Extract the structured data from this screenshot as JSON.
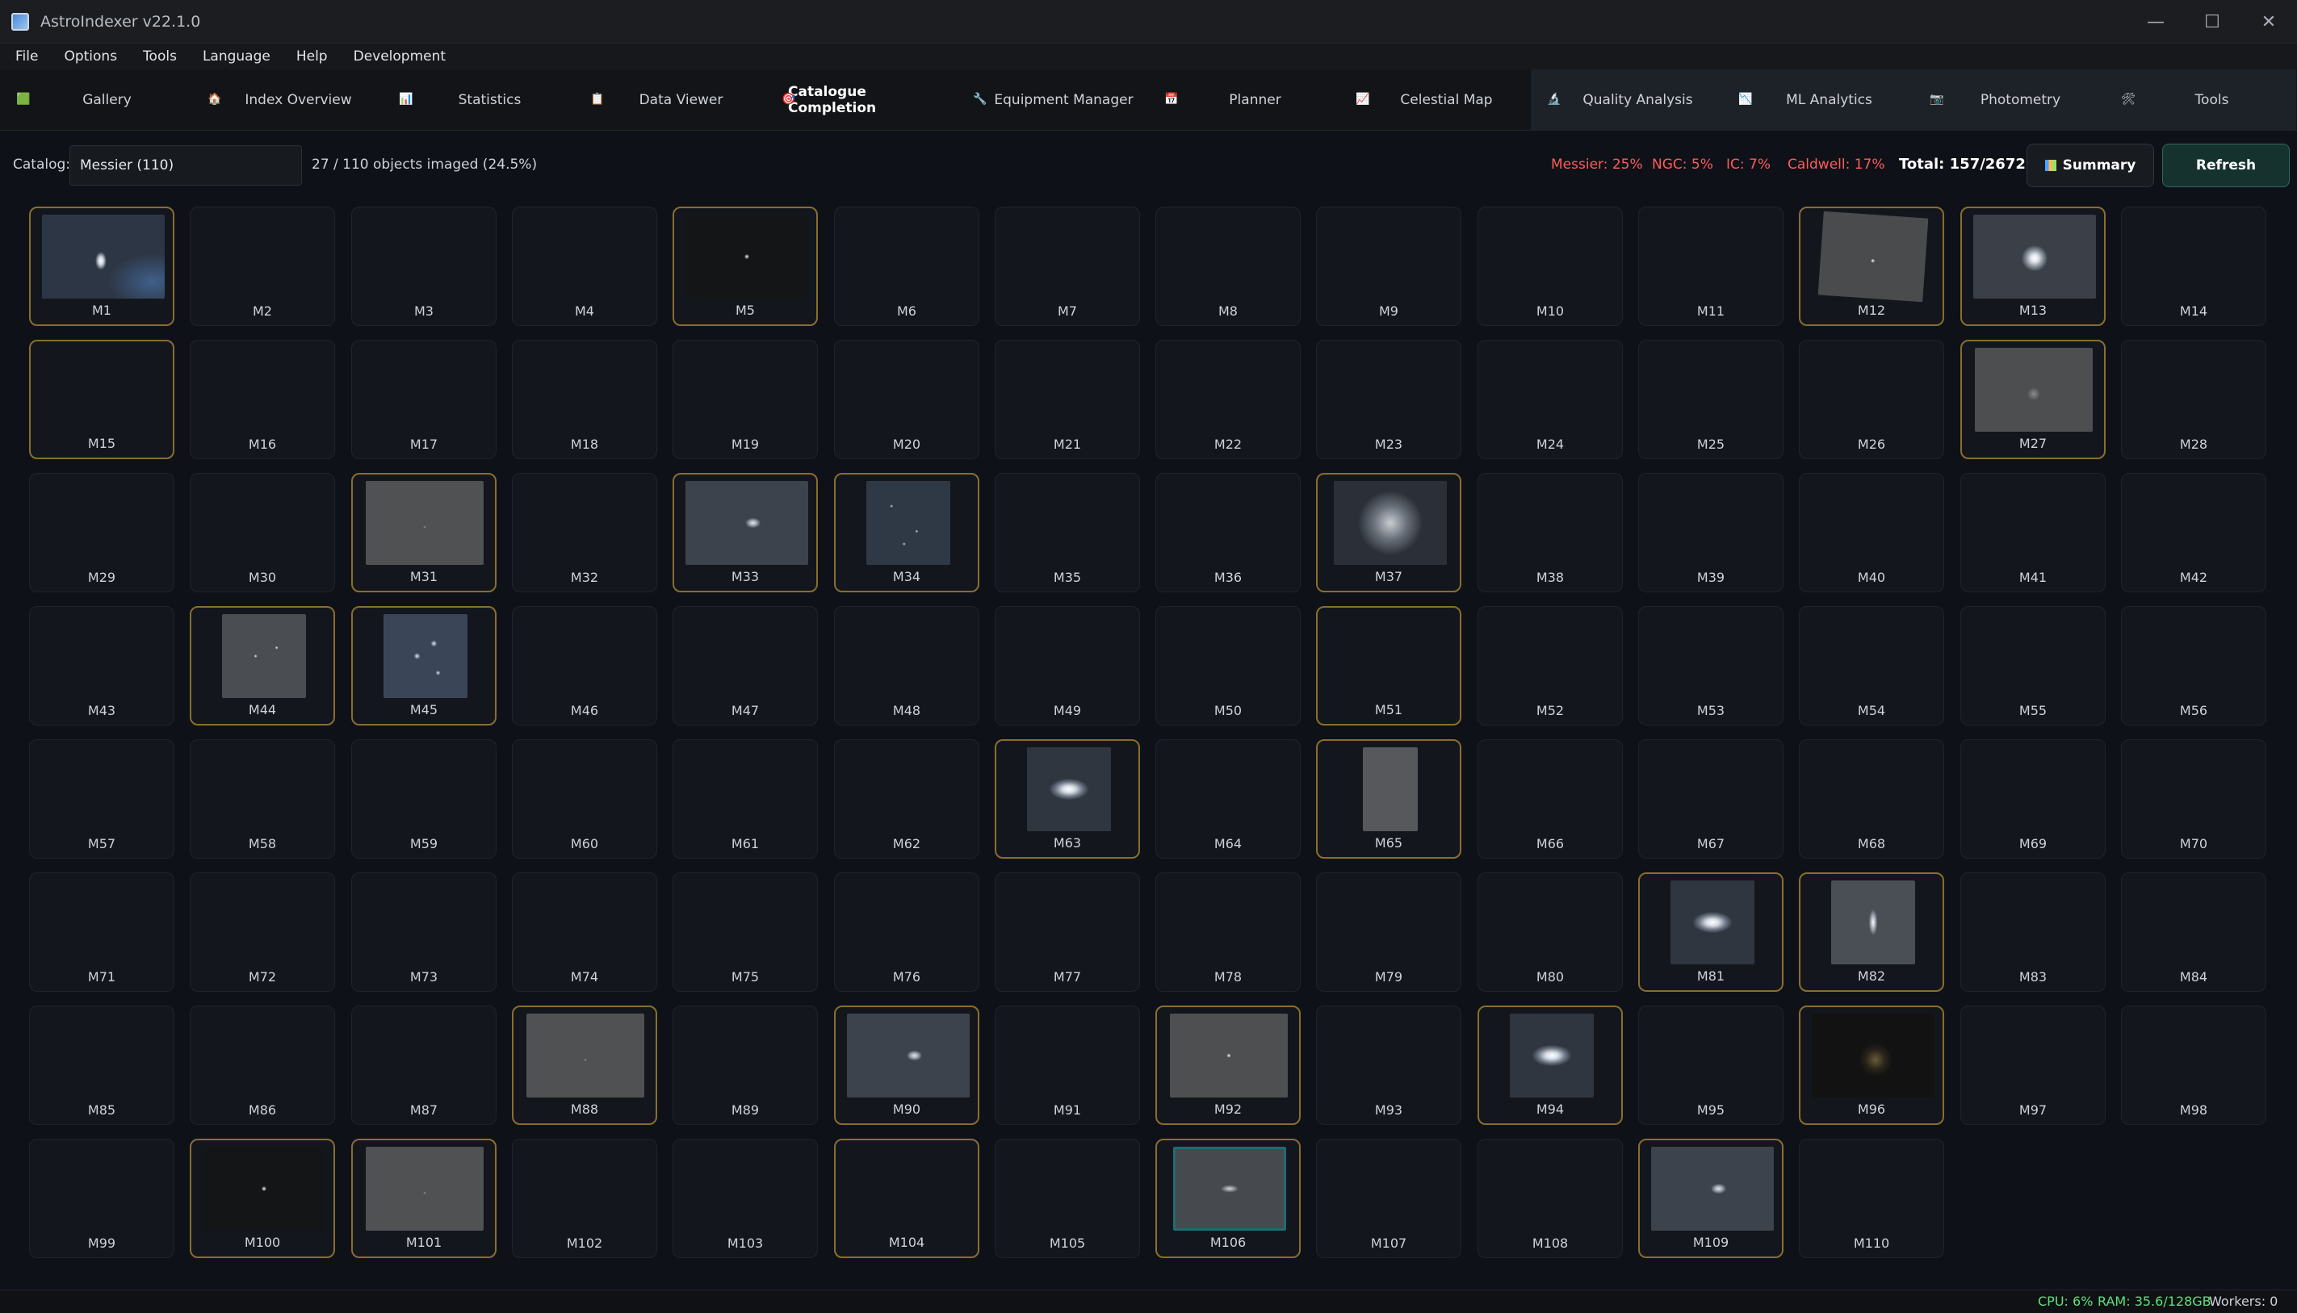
{
  "window": {
    "title": "AstroIndexer v22.1.0",
    "controls": {
      "minimize": "—",
      "maximize": "☐",
      "close": "✕"
    }
  },
  "menu": [
    "File",
    "Options",
    "Tools",
    "Language",
    "Help",
    "Development"
  ],
  "tabs": [
    {
      "label": "Gallery",
      "icon": "🟩",
      "dark": false,
      "active": false
    },
    {
      "label": "Index  Overview",
      "icon": "🏠",
      "dark": false,
      "active": false
    },
    {
      "label": "Statistics",
      "icon": "📊",
      "dark": false,
      "active": false
    },
    {
      "label": "Data Viewer",
      "icon": "📋",
      "dark": false,
      "active": false
    },
    {
      "label": "Catalogue Completion",
      "icon": "🎯",
      "dark": false,
      "active": true
    },
    {
      "label": "Equipment Manager",
      "icon": "🔧",
      "dark": false,
      "active": false
    },
    {
      "label": "Planner",
      "icon": "📅",
      "dark": false,
      "active": false
    },
    {
      "label": "Celestial Map",
      "icon": "📈",
      "dark": false,
      "active": false
    },
    {
      "label": "Quality Analysis",
      "icon": "🔬",
      "dark": true,
      "active": false
    },
    {
      "label": "ML Analytics",
      "icon": "📉",
      "dark": true,
      "active": false
    },
    {
      "label": "Photometry",
      "icon": "📷",
      "dark": true,
      "active": false
    },
    {
      "label": "Tools",
      "icon": "🛠",
      "dark": true,
      "active": false
    }
  ],
  "toolbar": {
    "catalog_label": "Catalog:",
    "catalog_value": "Messier (110)",
    "progress": "27 / 110 objects imaged (24.5%)",
    "stats": {
      "messier": "Messier: 25%",
      "ngc": "NGC: 5%",
      "ic": "IC: 7%",
      "caldwell": "Caldwell: 17%"
    },
    "total": "Total: 157/2672",
    "summary_label": "Summary",
    "refresh_label": "Refresh"
  },
  "objects": [
    {
      "id": "M1",
      "imaged": true,
      "thumb": "nebula-galaxy"
    },
    {
      "id": "M2",
      "imaged": false
    },
    {
      "id": "M3",
      "imaged": false
    },
    {
      "id": "M4",
      "imaged": false
    },
    {
      "id": "M5",
      "imaged": true,
      "thumb": "dark-point"
    },
    {
      "id": "M6",
      "imaged": false
    },
    {
      "id": "M7",
      "imaged": false
    },
    {
      "id": "M8",
      "imaged": false
    },
    {
      "id": "M9",
      "imaged": false
    },
    {
      "id": "M10",
      "imaged": false
    },
    {
      "id": "M11",
      "imaged": false
    },
    {
      "id": "M12",
      "imaged": true,
      "thumb": "gray-rotated"
    },
    {
      "id": "M13",
      "imaged": true,
      "thumb": "globular"
    },
    {
      "id": "M14",
      "imaged": false
    },
    {
      "id": "M15",
      "imaged": true,
      "thumb": "empty"
    },
    {
      "id": "M16",
      "imaged": false
    },
    {
      "id": "M17",
      "imaged": false
    },
    {
      "id": "M18",
      "imaged": false
    },
    {
      "id": "M19",
      "imaged": false
    },
    {
      "id": "M20",
      "imaged": false
    },
    {
      "id": "M21",
      "imaged": false
    },
    {
      "id": "M22",
      "imaged": false
    },
    {
      "id": "M23",
      "imaged": false
    },
    {
      "id": "M24",
      "imaged": false
    },
    {
      "id": "M25",
      "imaged": false
    },
    {
      "id": "M26",
      "imaged": false
    },
    {
      "id": "M27",
      "imaged": true,
      "thumb": "gray-blob"
    },
    {
      "id": "M28",
      "imaged": false
    },
    {
      "id": "M29",
      "imaged": false
    },
    {
      "id": "M30",
      "imaged": false
    },
    {
      "id": "M31",
      "imaged": true,
      "thumb": "gray-plain"
    },
    {
      "id": "M32",
      "imaged": false
    },
    {
      "id": "M33",
      "imaged": true,
      "thumb": "gray-galaxy"
    },
    {
      "id": "M34",
      "imaged": true,
      "thumb": "open-cluster"
    },
    {
      "id": "M35",
      "imaged": false
    },
    {
      "id": "M36",
      "imaged": false
    },
    {
      "id": "M37",
      "imaged": true,
      "thumb": "dense-cluster"
    },
    {
      "id": "M38",
      "imaged": false
    },
    {
      "id": "M39",
      "imaged": false
    },
    {
      "id": "M40",
      "imaged": false
    },
    {
      "id": "M41",
      "imaged": false
    },
    {
      "id": "M42",
      "imaged": false
    },
    {
      "id": "M43",
      "imaged": false
    },
    {
      "id": "M44",
      "imaged": true,
      "thumb": "sparse-cluster"
    },
    {
      "id": "M45",
      "imaged": true,
      "thumb": "pleiades"
    },
    {
      "id": "M46",
      "imaged": false
    },
    {
      "id": "M47",
      "imaged": false
    },
    {
      "id": "M48",
      "imaged": false
    },
    {
      "id": "M49",
      "imaged": false
    },
    {
      "id": "M50",
      "imaged": false
    },
    {
      "id": "M51",
      "imaged": true,
      "thumb": "empty"
    },
    {
      "id": "M52",
      "imaged": false
    },
    {
      "id": "M53",
      "imaged": false
    },
    {
      "id": "M54",
      "imaged": false
    },
    {
      "id": "M55",
      "imaged": false
    },
    {
      "id": "M56",
      "imaged": false
    },
    {
      "id": "M57",
      "imaged": false
    },
    {
      "id": "M58",
      "imaged": false
    },
    {
      "id": "M59",
      "imaged": false
    },
    {
      "id": "M60",
      "imaged": false
    },
    {
      "id": "M61",
      "imaged": false
    },
    {
      "id": "M62",
      "imaged": false
    },
    {
      "id": "M63",
      "imaged": true,
      "thumb": "spiral-bright"
    },
    {
      "id": "M64",
      "imaged": false
    },
    {
      "id": "M65",
      "imaged": true,
      "thumb": "gray-narrow"
    },
    {
      "id": "M66",
      "imaged": false
    },
    {
      "id": "M67",
      "imaged": false
    },
    {
      "id": "M68",
      "imaged": false
    },
    {
      "id": "M69",
      "imaged": false
    },
    {
      "id": "M70",
      "imaged": false
    },
    {
      "id": "M71",
      "imaged": false
    },
    {
      "id": "M72",
      "imaged": false
    },
    {
      "id": "M73",
      "imaged": false
    },
    {
      "id": "M74",
      "imaged": false
    },
    {
      "id": "M75",
      "imaged": false
    },
    {
      "id": "M76",
      "imaged": false
    },
    {
      "id": "M77",
      "imaged": false
    },
    {
      "id": "M78",
      "imaged": false
    },
    {
      "id": "M79",
      "imaged": false
    },
    {
      "id": "M80",
      "imaged": false
    },
    {
      "id": "M81",
      "imaged": true,
      "thumb": "spiral-bright"
    },
    {
      "id": "M82",
      "imaged": true,
      "thumb": "edge-on"
    },
    {
      "id": "M83",
      "imaged": false
    },
    {
      "id": "M84",
      "imaged": false
    },
    {
      "id": "M85",
      "imaged": false
    },
    {
      "id": "M86",
      "imaged": false
    },
    {
      "id": "M87",
      "imaged": false
    },
    {
      "id": "M88",
      "imaged": true,
      "thumb": "gray-plain"
    },
    {
      "id": "M89",
      "imaged": false
    },
    {
      "id": "M90",
      "imaged": true,
      "thumb": "gray-galaxy"
    },
    {
      "id": "M91",
      "imaged": false
    },
    {
      "id": "M92",
      "imaged": true,
      "thumb": "gray-point"
    },
    {
      "id": "M93",
      "imaged": false
    },
    {
      "id": "M94",
      "imaged": true,
      "thumb": "spiral-bright"
    },
    {
      "id": "M95",
      "imaged": false
    },
    {
      "id": "M96",
      "imaged": true,
      "thumb": "dark-glow"
    },
    {
      "id": "M97",
      "imaged": false
    },
    {
      "id": "M98",
      "imaged": false
    },
    {
      "id": "M99",
      "imaged": false
    },
    {
      "id": "M100",
      "imaged": true,
      "thumb": "dark-point"
    },
    {
      "id": "M101",
      "imaged": true,
      "thumb": "gray-plain"
    },
    {
      "id": "M102",
      "imaged": false
    },
    {
      "id": "M103",
      "imaged": false
    },
    {
      "id": "M104",
      "imaged": true,
      "thumb": "empty"
    },
    {
      "id": "M105",
      "imaged": false
    },
    {
      "id": "M106",
      "imaged": true,
      "thumb": "teal-galaxy"
    },
    {
      "id": "M107",
      "imaged": false
    },
    {
      "id": "M108",
      "imaged": false
    },
    {
      "id": "M109",
      "imaged": true,
      "thumb": "gray-galaxy"
    },
    {
      "id": "M110",
      "imaged": false
    }
  ],
  "status": {
    "cpu": "CPU: 6%",
    "ram": "RAM: 35.6/128GB",
    "workers": "Workers: 0"
  },
  "colors": {
    "accent_red": "#ff5b5b",
    "imaged_border": "#8a6d2e",
    "status_green": "#5fe07a"
  }
}
